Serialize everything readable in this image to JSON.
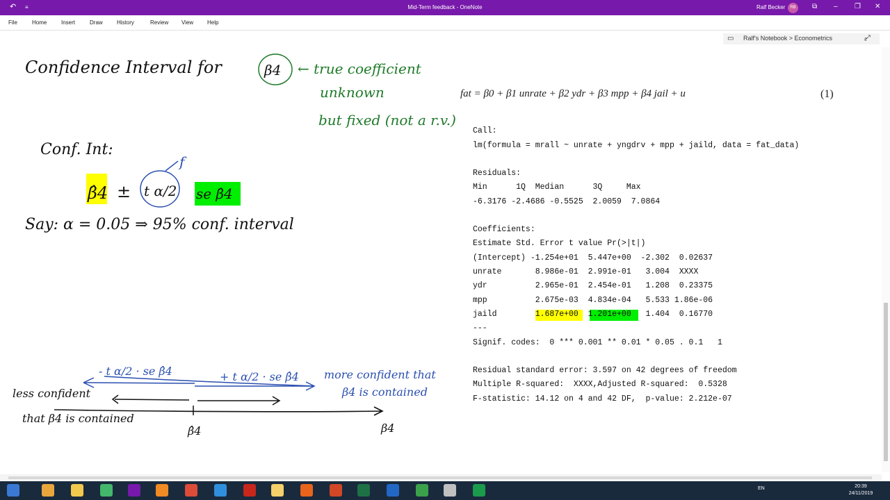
{
  "window": {
    "title": "Mid-Term feedback - OneNote",
    "user_name": "Ralf Becker",
    "user_initials": "RB"
  },
  "menu": [
    "File",
    "Home",
    "Insert",
    "Draw",
    "History",
    "Review",
    "View",
    "Help"
  ],
  "notebook": {
    "breadcrumb": "Ralf's Notebook > Econometrics"
  },
  "equation": {
    "text": "fat = β0 + β1 unrate + β2 ydr + β3 mpp + β4 jail + u",
    "number": "(1)"
  },
  "r_output": {
    "call_header": "Call:",
    "call": "lm(formula = mrall ~ unrate + yngdrv + mpp + jaild, data = fat_data)",
    "residuals_header": "Residuals:",
    "residuals_labels": "Min      1Q  Median      3Q     Max",
    "residuals_values": "-6.3176 -2.4686 -0.5525  2.0059  7.0864",
    "coef_header": "Coefficients:",
    "coef_columns": "Estimate Std. Error t value Pr(>|t|)",
    "coef_rows": [
      "(Intercept) -1.254e+01  5.447e+00  -2.302  0.02637",
      "unrate       8.986e-01  2.991e-01   3.004  XXXX",
      "ydr          2.965e-01  2.454e-01   1.208  0.23375",
      "mpp          2.675e-03  4.834e-04   5.533 1.86e-06",
      "jaild        1.687e+00  1.201e+00   1.404  0.16770"
    ],
    "separator": "---",
    "signif": "Signif. codes:  0 *** 0.001 ** 0.01 * 0.05 . 0.1   1",
    "rse": "Residual standard error: 3.597 on 42 degrees of freedom",
    "r2": "Multiple R-squared:  XXXX,Adjusted R-squared:  0.5328",
    "fstat": "F-statistic: 14.12 on 4 and 42 DF,  p-value: 2.212e-07"
  },
  "handwriting": {
    "title": "Confidence Interval for",
    "beta4": "β4",
    "true_coef_1": "← true coefficient",
    "true_coef_2": "unknown",
    "true_coef_3": "but fixed (not a r.v.)",
    "conf_int": "Conf. Int:",
    "formula_beta": "β̂4",
    "formula_pm": "±",
    "formula_t": "t α/2",
    "formula_se": "se β̂4",
    "formula_f": "f",
    "say_line": "Say: α = 0.05  ⇒  95% conf. interval",
    "minus_t": "- t α/2 · se β̂4",
    "plus_t": "+ t α/2 · se β̂4",
    "more_conf_1": "more confident that",
    "more_conf_2": "β4 is contained",
    "less_conf_1": "less confident",
    "less_conf_2": "that β4 is contained",
    "axis_beta_hat": "β̂4",
    "axis_beta": "β4"
  },
  "colors": {
    "accent": "#7719aa",
    "ink_black": "#111111",
    "ink_green": "#1f7a2a",
    "ink_blue": "#2a4fb0",
    "highlight_yellow": "#ffff00",
    "highlight_green": "#00ee00"
  },
  "taskbar": {
    "language": "EN",
    "time": "20:39",
    "date": "24/11/2019"
  }
}
